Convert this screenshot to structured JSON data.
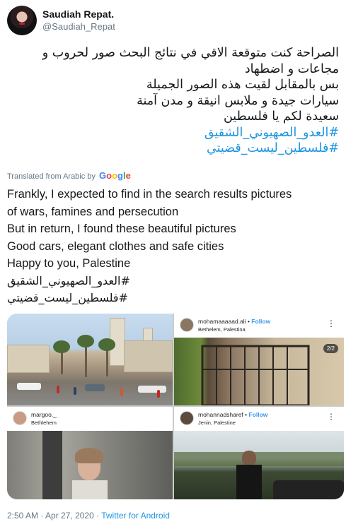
{
  "author": {
    "display_name": "Saudiah Repat.",
    "handle": "@Saudiah_Repat",
    "avatar_icon": "profile-photo"
  },
  "tweet": {
    "arabic_lines": [
      "الصراحة كنت متوقعة الاقي في نتائج البحث صور لحروب و",
      "مجاعات و اضطهاد",
      "بس بالمقابل لقيت هذه الصور الجميلة",
      "سيارات جيدة و ملابس انيقة و مدن آمنة",
      "سعيدة لكم يا فلسطين"
    ],
    "hashtags": [
      "#العدو_الصهيوني_الشقيق",
      "#فلسطين_ليست_قضيتي"
    ],
    "translated_label": "Translated from Arabic by",
    "translator": "Google",
    "translation_lines": [
      "Frankly, I expected to find in the search results pictures",
      "of wars, famines and persecution",
      " But in return, I found these beautiful pictures",
      " Good cars, elegant clothes and safe cities",
      " Happy to you, Palestine"
    ],
    "translation_hashtags": [
      "#العدو_الصهيوني_الشقيق",
      "#فلسطين_ليست_قضيتي"
    ]
  },
  "media": {
    "tile2": {
      "username": "mohamaaaaad.ali",
      "separator": " • ",
      "follow": "Follow",
      "location": "Bethelem, Palestina",
      "counter": "2/2",
      "menu_icon": "more-vertical-icon"
    },
    "tile3": {
      "username": "margoo._",
      "location": "Bethlehem"
    },
    "tile4": {
      "username": "mohannadsharef",
      "separator": " • ",
      "follow": "Follow",
      "location": "Jenin, Palestine",
      "menu_icon": "more-vertical-icon"
    }
  },
  "footer": {
    "time": "2:50 AM",
    "separator": " · ",
    "date": "Apr 27, 2020",
    "source": "Twitter for Android"
  },
  "colors": {
    "link": "#1b95e0",
    "secondary_text": "#657786",
    "primary_text": "#14171a"
  }
}
